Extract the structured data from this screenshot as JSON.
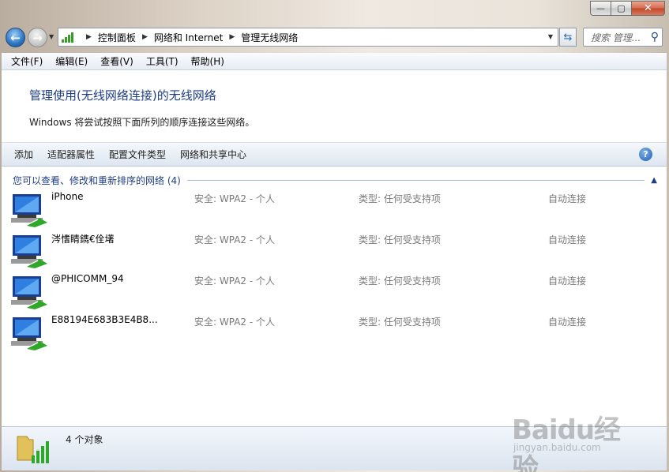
{
  "window": {
    "caption": {
      "minimize": "—",
      "maximize": "▢",
      "close": "✕"
    }
  },
  "address_bar": {
    "breadcrumbs": [
      "控制面板",
      "网络和 Internet",
      "管理无线网络"
    ],
    "search_placeholder": "搜索 管理..."
  },
  "menu": {
    "items": [
      "文件(F)",
      "编辑(E)",
      "查看(V)",
      "工具(T)",
      "帮助(H)"
    ]
  },
  "page": {
    "title": "管理使用(无线网络连接)的无线网络",
    "description": "Windows 将尝试按照下面所列的顺序连接这些网络。"
  },
  "toolbar": {
    "commands": [
      "添加",
      "适配器属性",
      "配置文件类型",
      "网络和共享中心"
    ],
    "help": "?"
  },
  "group": {
    "title": "您可以查看、修改和重新排序的网络 (4)"
  },
  "networks": [
    {
      "name": "iPhone",
      "security": "安全: WPA2 - 个人",
      "type": "类型: 任何受支持项",
      "mode": "自动连接"
    },
    {
      "name": "涔愭睛鐫€佺墸",
      "security": "安全: WPA2 - 个人",
      "type": "类型: 任何受支持项",
      "mode": "自动连接"
    },
    {
      "name": "@PHICOMM_94",
      "security": "安全: WPA2 - 个人",
      "type": "类型: 任何受支持项",
      "mode": "自动连接"
    },
    {
      "name": "E88194E683B3E4B8...",
      "security": "安全: WPA2 - 个人",
      "type": "类型: 任何受支持项",
      "mode": "自动连接"
    }
  ],
  "status": {
    "count": "4 个对象"
  },
  "watermark": {
    "main": "Baidu经验",
    "sub": "jingyan.baidu.com"
  },
  "colors": {
    "title_blue": "#1e3d87",
    "link_blue": "#1e3d87",
    "secondary_text": "#7a7a7a"
  }
}
